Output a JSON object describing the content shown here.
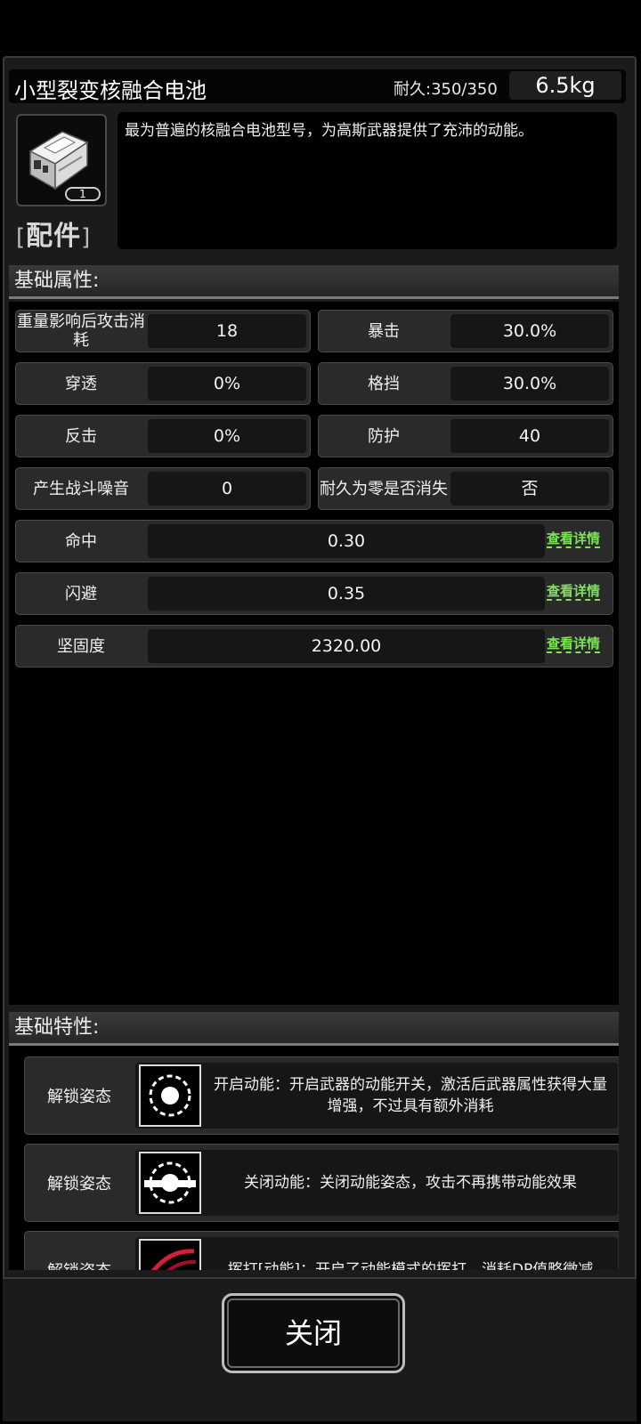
{
  "item": {
    "name": "小型裂变核融合电池",
    "durability": "耐久:350/350",
    "weight": "6.5kg",
    "count": "1",
    "type_label": "配件",
    "type_bracket_left": "[",
    "type_bracket_right": "]",
    "description": "最为普遍的核融合电池型号，为高斯武器提供了充沛的动能。",
    "icon": "battery-icon"
  },
  "attributes": {
    "header": "基础属性:",
    "pairs": [
      {
        "label": "重量影响后攻击消耗",
        "value": "18"
      },
      {
        "label": "暴击",
        "value": "30.0%"
      },
      {
        "label": "穿透",
        "value": "0%"
      },
      {
        "label": "格挡",
        "value": "30.0%"
      },
      {
        "label": "反击",
        "value": "0%"
      },
      {
        "label": "防护",
        "value": "40"
      },
      {
        "label": "产生战斗噪音",
        "value": "0"
      },
      {
        "label": "耐久为零是否消失",
        "value": "否"
      }
    ],
    "wide": [
      {
        "label": "命中",
        "value": "0.30",
        "link": "查看详情"
      },
      {
        "label": "闪避",
        "value": "0.35",
        "link": "查看详情"
      },
      {
        "label": "坚固度",
        "value": "2320.00",
        "link": "查看详情"
      }
    ]
  },
  "traits": {
    "header": "基础特性:",
    "items": [
      {
        "label": "解锁姿态",
        "icon": "gear-circle-icon",
        "desc": "开启动能：开启武器的动能开关，激活后武器属性获得大量增强，不过具有额外消耗"
      },
      {
        "label": "解锁姿态",
        "icon": "gear-bar-icon",
        "desc": "关闭动能：关闭动能姿态，攻击不再携带动能效果"
      },
      {
        "label": "解锁姿态",
        "icon": "red-slash-icon",
        "desc": "挥打[动能]：开启了动能模式的挥打，消耗DP值略微减"
      }
    ]
  },
  "footer": {
    "close_label": "关闭"
  },
  "colors": {
    "link_green": "#7ee25a",
    "panel_bg": "#1b1b1b",
    "cell_bg": "#2a2a2a",
    "slash_red": "#d0203a"
  }
}
